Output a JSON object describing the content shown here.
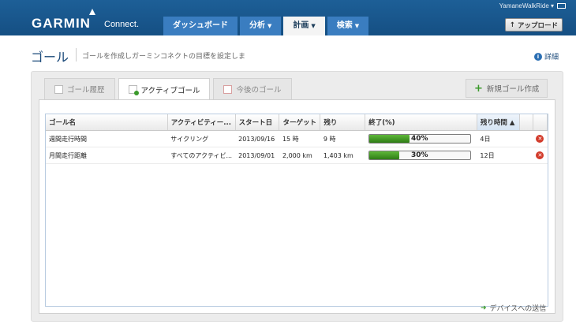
{
  "header": {
    "logo_text": "GARMIN",
    "logo_sub": "Connect.",
    "user_name": "YamaneWalkRide ▾",
    "upload_label": "アップロード",
    "nav": [
      {
        "label": "ダッシュボード"
      },
      {
        "label": "分析"
      },
      {
        "label": "計画"
      },
      {
        "label": "検索"
      }
    ]
  },
  "page": {
    "title": "ゴール",
    "description": "ゴールを作成しガーミンコネクトの目標を設定しま",
    "detail_link": "詳細"
  },
  "tabs": [
    {
      "label": "ゴール履歴"
    },
    {
      "label": "アクティブゴール"
    },
    {
      "label": "今後のゴール"
    }
  ],
  "new_goal_label": "新規ゴール作成",
  "table": {
    "headers": [
      "ゴール名",
      "アクティビティー...",
      "スタート日",
      "ターゲット",
      "残り",
      "終了(%)",
      "残り時間"
    ],
    "rows": [
      {
        "name": "週間走行時間",
        "activity": "サイクリング",
        "start": "2013/09/16",
        "target": "15 時",
        "remaining": "9 時",
        "percent_text": "40%",
        "percent": 40,
        "time_left": "4日"
      },
      {
        "name": "月間走行距離",
        "activity": "すべてのアクティビ...",
        "start": "2013/09/01",
        "target": "2,000 km",
        "remaining": "1,403 km",
        "percent_text": "30%",
        "percent": 30,
        "time_left": "12日"
      }
    ]
  },
  "send_label": "デバイスへの送信"
}
